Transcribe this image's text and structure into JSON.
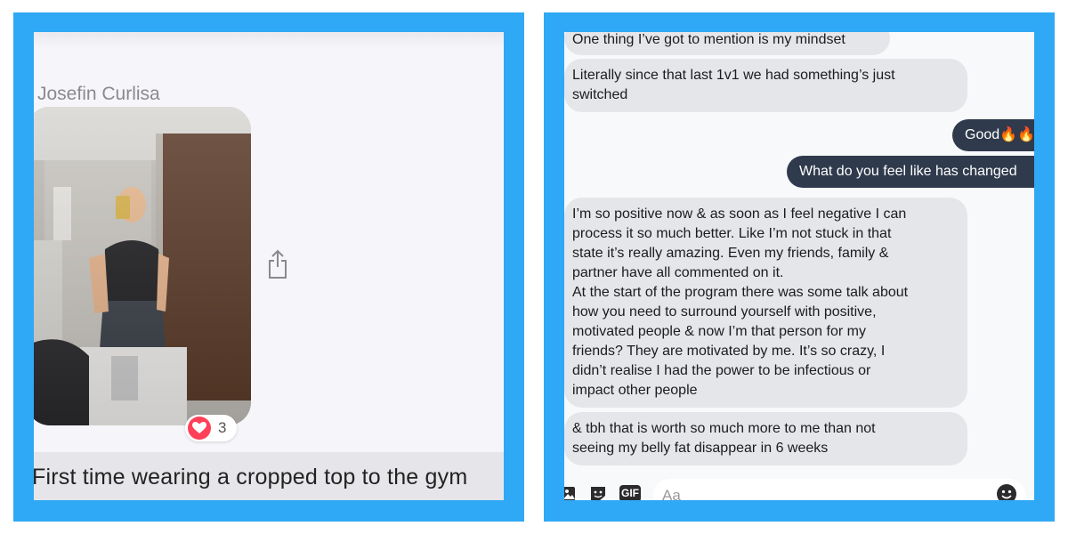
{
  "left_post": {
    "sender_name": "Josefin Curlisa",
    "reaction_count": "3",
    "caption": "First time wearing a cropped top to the gym",
    "icons": [
      "share-icon",
      "heart-icon"
    ]
  },
  "chat": {
    "messages": [
      {
        "direction": "incoming",
        "text": "One thing I’ve got to mention is my mindset"
      },
      {
        "direction": "incoming",
        "text": "Literally since that last 1v1 we had something’s just\nswitched"
      },
      {
        "direction": "outgoing",
        "text": "Good🔥🔥"
      },
      {
        "direction": "outgoing",
        "text": "What do you feel like has changed"
      },
      {
        "direction": "incoming",
        "text": "I’m so positive now & as soon as I feel negative I can\nprocess it so much better. Like I’m not stuck in that\nstate it’s really amazing. Even my friends, family &\npartner have all commented on it.\nAt the start of the program there was some talk about\nhow you need to surround yourself with positive,\nmotivated people & now I’m that person for my\nfriends? They are motivated by me. It’s so crazy, I\ndidn’t realise I had the power to be infectious or\nimpact other people"
      },
      {
        "direction": "incoming",
        "text": "& tbh that is worth so much more to me than not\nseeing my belly fat disappear in 6 weeks"
      }
    ],
    "composer": {
      "placeholder": "Aa",
      "gif_label": "GIF",
      "icons": [
        "photo-icon",
        "sticker-icon",
        "gif-icon",
        "emoji-icon"
      ]
    }
  },
  "colors": {
    "frame_blue": "#2fa9f5",
    "incoming_bubble": "#e5e6ea",
    "outgoing_bubble": "#2f3a4c",
    "reaction_heart": "#ff4058"
  }
}
